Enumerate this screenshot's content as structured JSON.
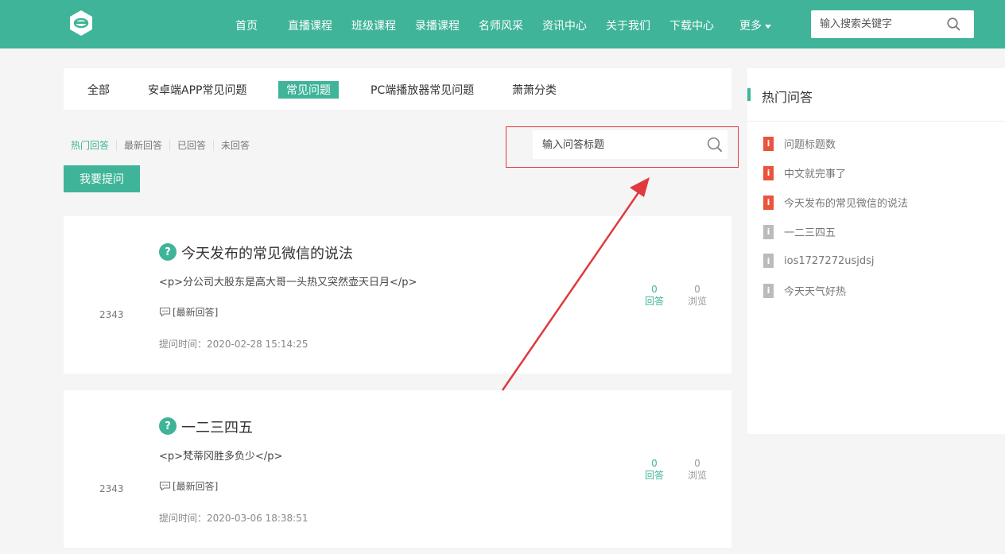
{
  "header": {
    "nav": [
      "首页",
      "直播课程",
      "班级课程",
      "录播课程",
      "名师风采",
      "资讯中心",
      "关于我们",
      "下载中心",
      "更多"
    ],
    "search_placeholder": "输入搜索关键字"
  },
  "tabs": [
    "全部",
    "安卓端APP常见问题",
    "常见问题",
    "PC端播放器常见问题",
    "萧萧分类"
  ],
  "active_tab": "常见问题",
  "filters": [
    "热门回答",
    "最新回答",
    "已回答",
    "未回答"
  ],
  "ask_button": "我要提问",
  "question_search_placeholder": "输入问答标题",
  "questions": [
    {
      "num": "2343",
      "title": "今天发布的常见微信的说法",
      "content": "<p>分公司大股东是高大哥一头热又突然壶天日月</p>",
      "latest": "[最新回答]",
      "time": "提问时间：2020-02-28 15:14:25",
      "answers": "0",
      "answers_label": "回答",
      "views": "0",
      "views_label": "浏览"
    },
    {
      "num": "2343",
      "title": "一二三四五",
      "content": "<p>梵蒂冈胜多负少</p>",
      "latest": "[最新回答]",
      "time": "提问时间：2020-03-06 18:38:51",
      "answers": "0",
      "answers_label": "回答",
      "views": "0",
      "views_label": "浏览"
    }
  ],
  "sidebar": {
    "title": "热门问答",
    "badge_text": "i",
    "items": [
      {
        "text": "问题标题数",
        "hot": true
      },
      {
        "text": "中文就完事了",
        "hot": true
      },
      {
        "text": "今天发布的常见微信的说法",
        "hot": true
      },
      {
        "text": "一二三四五",
        "hot": false
      },
      {
        "text": "ios1727272usjdsj",
        "hot": false
      },
      {
        "text": "今天天气好热",
        "hot": false
      }
    ]
  },
  "colors": {
    "brand": "#3fb498",
    "hot_badge": "#e9543d",
    "annotation": "#e0393e"
  }
}
